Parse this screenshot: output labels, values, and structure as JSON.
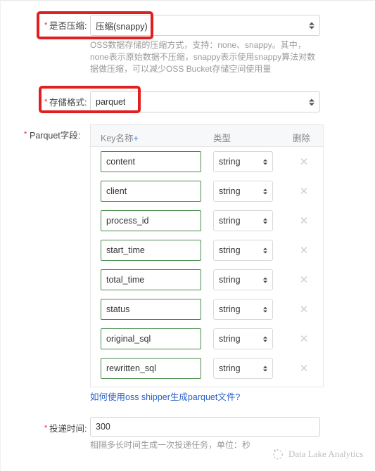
{
  "form": {
    "compression": {
      "label": "是否压缩:",
      "required": true,
      "value": "压缩(snappy)",
      "description_lines": [
        "OSS数据存储的压缩方式，支持：none、snappy。其中，",
        "none表示原始数据不压缩，snappy表示使用snappy算法对数",
        "据做压缩，可以减少OSS Bucket存储空间使用量"
      ]
    },
    "storage_format": {
      "label": "存储格式:",
      "required": true,
      "value": "parquet"
    },
    "parquet_fields": {
      "label": "Parquet字段:",
      "required": true,
      "columns": {
        "key": "Key名称",
        "key_add": "+",
        "type": "类型",
        "delete": "删除"
      },
      "rows": [
        {
          "key": "content",
          "type": "string",
          "delete_icon": "close-icon"
        },
        {
          "key": "client",
          "type": "string",
          "delete_icon": "close-icon"
        },
        {
          "key": "process_id",
          "type": "string",
          "delete_icon": "close-icon"
        },
        {
          "key": "start_time",
          "type": "string",
          "delete_icon": "close-icon"
        },
        {
          "key": "total_time",
          "type": "string",
          "delete_icon": "close-icon"
        },
        {
          "key": "status",
          "type": "string",
          "delete_icon": "close-icon"
        },
        {
          "key": "original_sql",
          "type": "string",
          "delete_icon": "close-icon"
        },
        {
          "key": "rewritten_sql",
          "type": "string",
          "delete_icon": "close-icon"
        }
      ],
      "help_link": "如何使用oss shipper生成parquet文件?"
    },
    "delivery_time": {
      "label": "投递时间:",
      "required": true,
      "value": "300",
      "description": "相隔多长时间生成一次投递任务，单位：秒"
    }
  },
  "annotations": {
    "box_color": "#e02020",
    "items": [
      {
        "name": "compression-highlight"
      },
      {
        "name": "storage-format-highlight"
      }
    ]
  },
  "watermark": {
    "text": "Data Lake Analytics",
    "icon": "dotted-circle-logo"
  },
  "colors": {
    "required_star": "#e8262b",
    "link": "#2a61c4",
    "input_border_active": "#4a8b4a",
    "input_border": "#d4d4d4",
    "panel_header_bg": "#f7f8fa",
    "muted_text": "#9a9a9a"
  }
}
